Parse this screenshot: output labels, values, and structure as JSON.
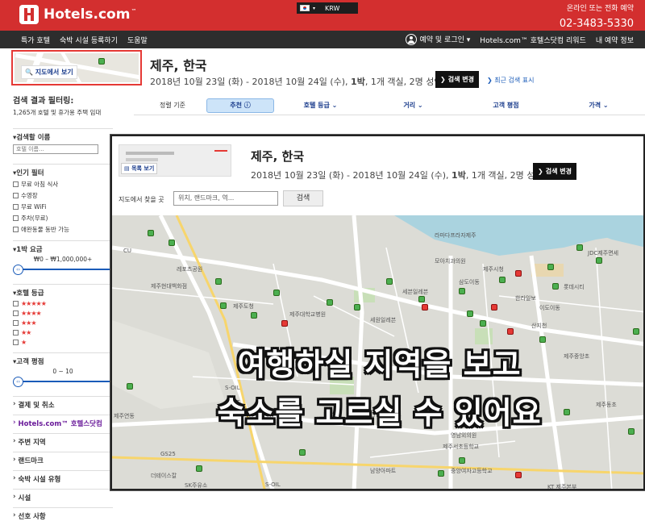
{
  "header": {
    "logo": "Hotels.com",
    "logo_tm": "™",
    "currency": "KRW",
    "call_label": "온라인 또는 전화 예약",
    "phone": "02-3483-5330"
  },
  "nav": {
    "left": [
      "특가 호텔",
      "숙박 시설 등록하기",
      "도움말"
    ],
    "login": "예약 및 로그인",
    "rewards": "Hotels.com™ 호텔스닷컴 리워드",
    "mytrips": "내 예약 정보"
  },
  "summary": {
    "map_button": "지도에서 보기",
    "city": "제주, 한국",
    "dates": "2018년 10월 23일 (화) - 2018년 10월 24일 (수), ",
    "nights": "1박",
    "rooms": ", 1개 객실, 2명 성인",
    "change_button": "검색 변경",
    "recent": "최근 검색 표시"
  },
  "filters": {
    "title": "검색 결과 필터링:",
    "count": "1,265개 호텔 및 휴가용 주택 임대",
    "name_head": "검색할 이름",
    "name_placeholder": "호텔 이름...",
    "popular_head": "인기 필터",
    "popular_items": [
      "무료 아침 식사",
      "수영장",
      "무료 WiFi",
      "주차(무료)",
      "애완동물 동반 가능"
    ],
    "price_head": "1박 요금",
    "price_range": "₩0 – ₩1,000,000+",
    "star_head": "호텔 등급",
    "stars": [
      "★★★★★",
      "★★★★",
      "★★★",
      "★★",
      "★"
    ],
    "rating_head": "고객 평점",
    "rating_range": "0 ~ 10",
    "payment": "결제 및 취소",
    "hotels_brand": "Hotels.com™ 호텔스닷컴",
    "area": "주변 지역",
    "landmark": "랜드마크",
    "type": "숙박 시설 유형",
    "facility": "시설",
    "preference": "선호 사항"
  },
  "sortbar": {
    "label": "정렬 기준",
    "active": "추천 ⓘ",
    "options": [
      "호텔 등급",
      "거리",
      "고객 평점",
      "가격"
    ]
  },
  "overlay": {
    "list_button": "목록 보기",
    "city": "제주, 한국",
    "dates": "2018년 10월 23일 (화) - 2018년 10월 24일 (수), ",
    "nights": "1박",
    "rooms": ", 1개 객실, 2명 성인",
    "change_button": "검색 변경",
    "search_label": "지도에서 찾을 곳",
    "search_placeholder": "위치, 랜드마크, 역...",
    "search_button": "검색",
    "caption_line1": "여행하실 지역을 보고",
    "caption_line2": "숙소를 고르실 수 있어요",
    "map_labels": [
      "제주현대백화점",
      "레포츠공원",
      "제주도청",
      "제주대학교병원",
      "세원일레븐",
      "현대3차아파트",
      "현천초등학교",
      "남양아파트",
      "중앙여자고등학교",
      "제주서초등학교",
      "모아치과의원",
      "삼도이동",
      "이도이동",
      "JDC제주면세",
      "제주중앙초",
      "제주동초",
      "제주연동",
      "CU",
      "GS25",
      "세븐일레븐",
      "더테이스칼",
      "SK주유소",
      "S-OIL",
      "KT",
      "KT 제주본부",
      "산지천",
      "제주시청",
      "롯데시티",
      "라마다프라자제주",
      "영남외의원",
      "한라일보",
      "S-OIL"
    ]
  }
}
